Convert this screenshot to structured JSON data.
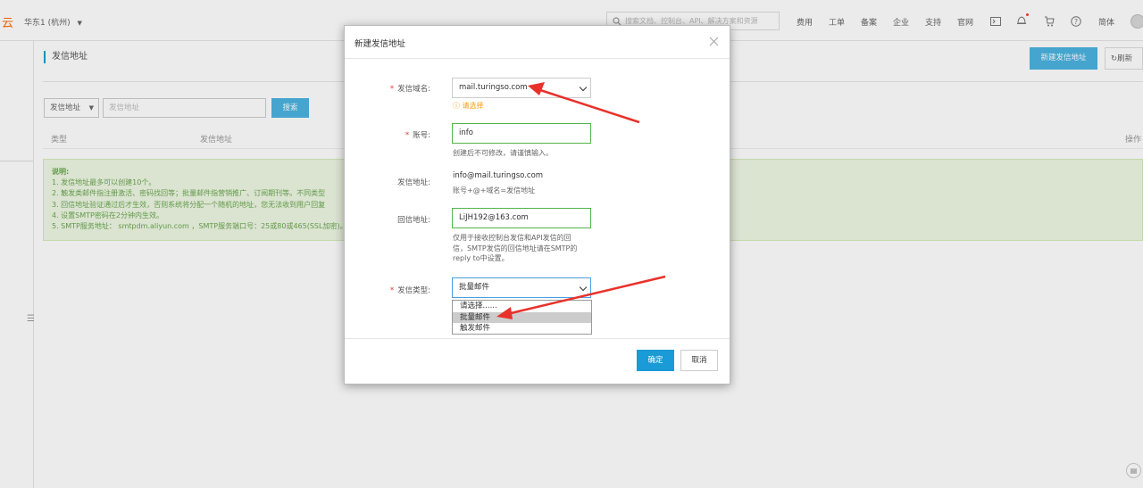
{
  "topbar": {
    "logo": "云",
    "region": "华东1 (杭州)",
    "search_placeholder": "搜索文档、控制台、API、解决方案和资源",
    "nav": [
      "费用",
      "工单",
      "备案",
      "企业",
      "支持",
      "官网"
    ],
    "lang": "简体"
  },
  "page": {
    "title": "发信地址",
    "new_button": "新建发信地址",
    "refresh": "刷新",
    "filter_select": "发信地址",
    "filter_placeholder": "发信地址",
    "search_button": "搜索",
    "columns": [
      "类型",
      "发信地址",
      "操作"
    ]
  },
  "notice": {
    "title": "说明:",
    "lines": [
      "1. 发信地址最多可以创建10个。",
      "2. 触发类邮件指注册激活、密码找回等；批量邮件指营销推广、订阅期刊等。不同类型",
      "3. 回信地址验证通过后才生效，否则系统将分配一个随机的地址，您无法收到用户回复",
      "4. 设置SMTP密码在2分钟内生效。",
      "5. SMTP服务地址： smtpdm.aliyun.com ，SMTP服务端口号：25或80或465(SSL加密)。"
    ]
  },
  "modal": {
    "title": "新建发信地址",
    "domain_label": "发信域名:",
    "domain_value": "mail.turingso.com",
    "domain_hint": "请选择",
    "account_label": "账号:",
    "account_value": "info",
    "account_hint": "创建后不可修改，请谨慎输入。",
    "address_label": "发信地址:",
    "address_value": "info@mail.turingso.com",
    "address_hint": "账号+@+域名=发信地址",
    "reply_label": "回信地址:",
    "reply_value": "LiJH192@163.com",
    "reply_hint": [
      "仅用于接收控制台发信和API发信的回",
      "信，SMTP发信的回信地址请在SMTP的",
      "reply to中设置。"
    ],
    "type_label": "发信类型:",
    "type_value": "批量邮件",
    "type_options": [
      "请选择......",
      "批量邮件",
      "触发邮件"
    ],
    "confirm": "确定",
    "cancel": "取消"
  },
  "colors": {
    "accent": "#4bb4e0",
    "arrow": "#e8312a",
    "required": "#e4393c",
    "valid_border": "#52b44b",
    "notice_bg": "#eef7e3",
    "notice_text": "#6aa84f",
    "warning": "#f39c12"
  }
}
